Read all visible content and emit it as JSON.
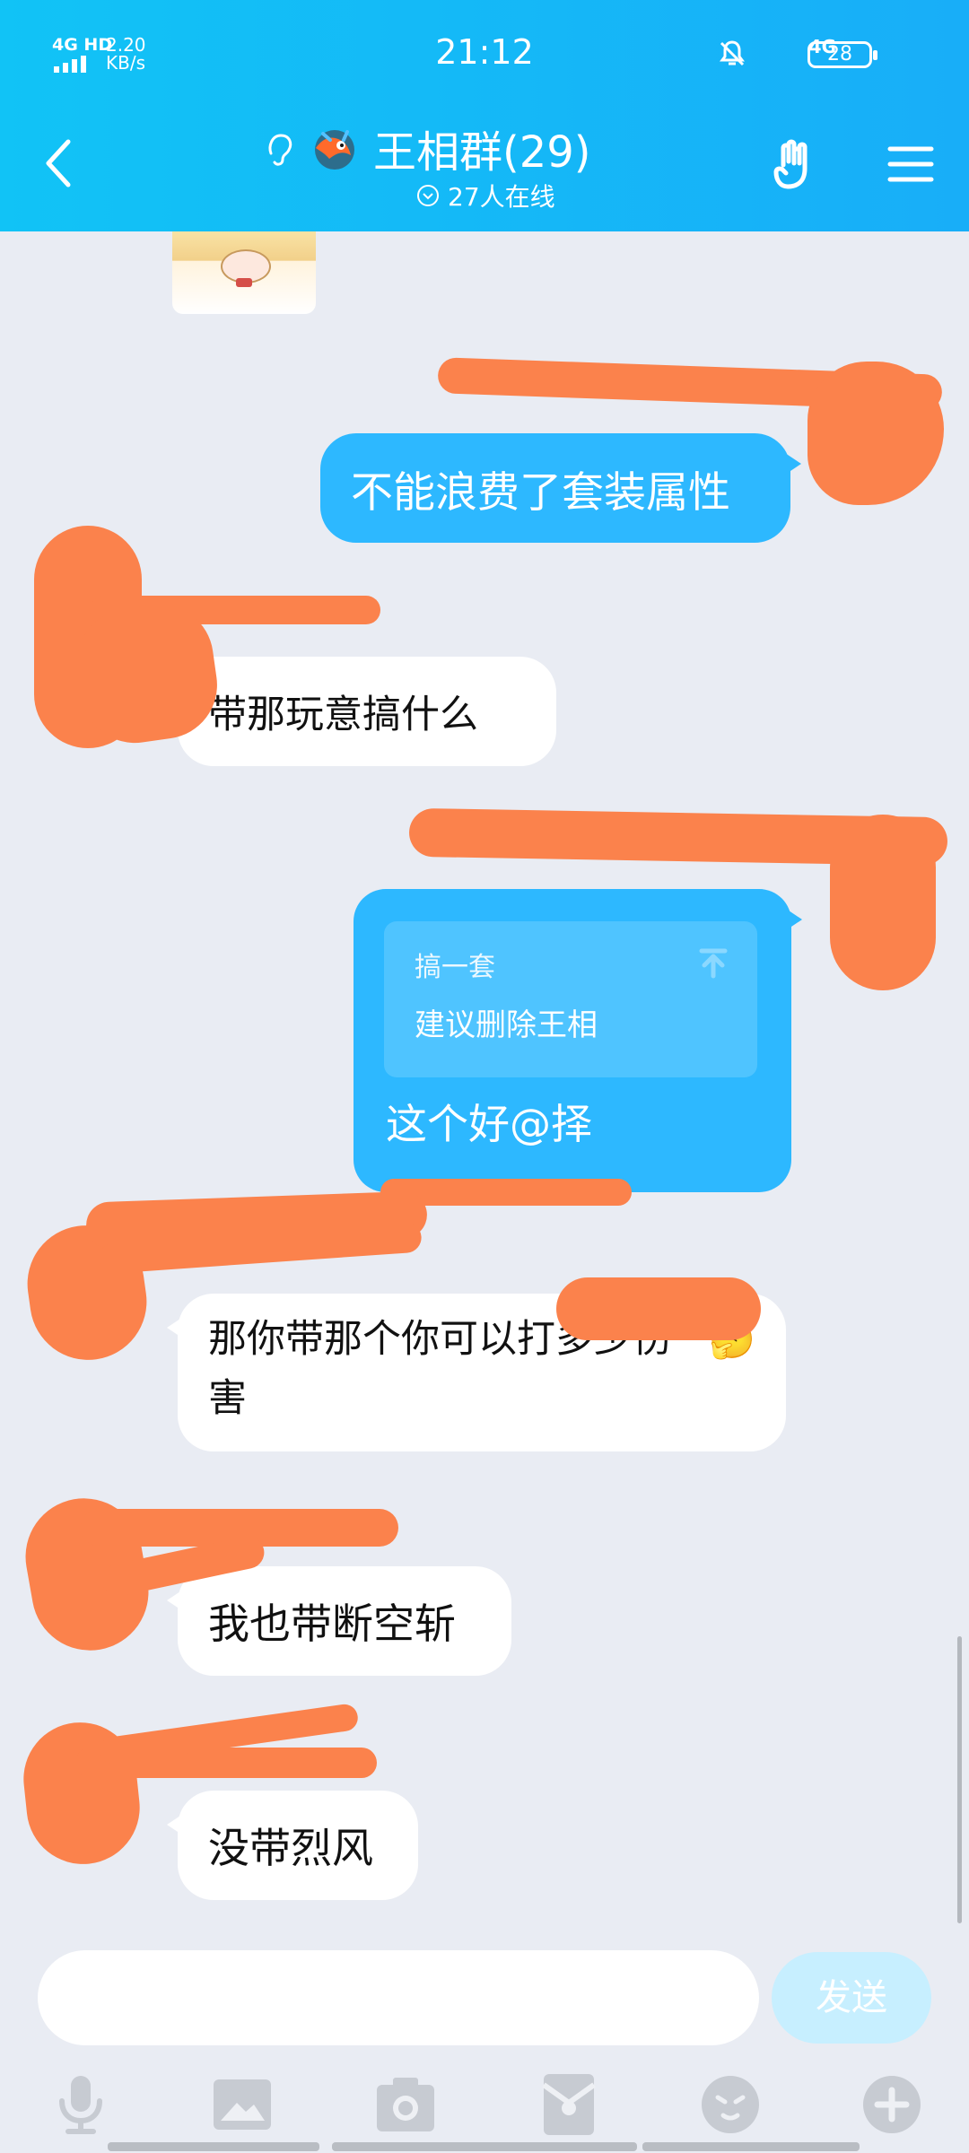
{
  "status_bar": {
    "network": "4G HD",
    "speed_value": "2.20",
    "speed_unit": "KB/s",
    "time": "21:12",
    "signal_type": "4G",
    "battery": "28"
  },
  "header": {
    "title": "王相群(29)",
    "online_text": "27人在线",
    "icons": [
      "back-icon",
      "ear-icon",
      "dragon-avatar-icon",
      "rock-hand-icon",
      "menu-icon"
    ]
  },
  "messages": [
    {
      "side": "out",
      "text": "不能浪费了套装属性"
    },
    {
      "side": "in",
      "text": "带那玩意搞什么",
      "style": "handwritten"
    },
    {
      "side": "out",
      "quote_title": "搞一套",
      "quote_line": "建议删除王相",
      "text": "这个好@择"
    },
    {
      "side": "in",
      "text": "那你带那个你可以打多少伤害",
      "emoji": "🤔",
      "style": "handwritten"
    },
    {
      "side": "in",
      "text": "我也带断空斩"
    },
    {
      "side": "in",
      "text": "没带烈风"
    }
  ],
  "composer": {
    "input_value": "",
    "send_label": "发送",
    "tools": [
      "microphone-icon",
      "image-icon",
      "camera-icon",
      "red-envelope-icon",
      "emoji-icon",
      "plus-icon"
    ]
  },
  "colors": {
    "header_blue": "#1bb5f7",
    "bubble_blue": "#2db8ff",
    "chat_bg": "#e9ecf3",
    "redaction_orange": "#fb824c"
  }
}
